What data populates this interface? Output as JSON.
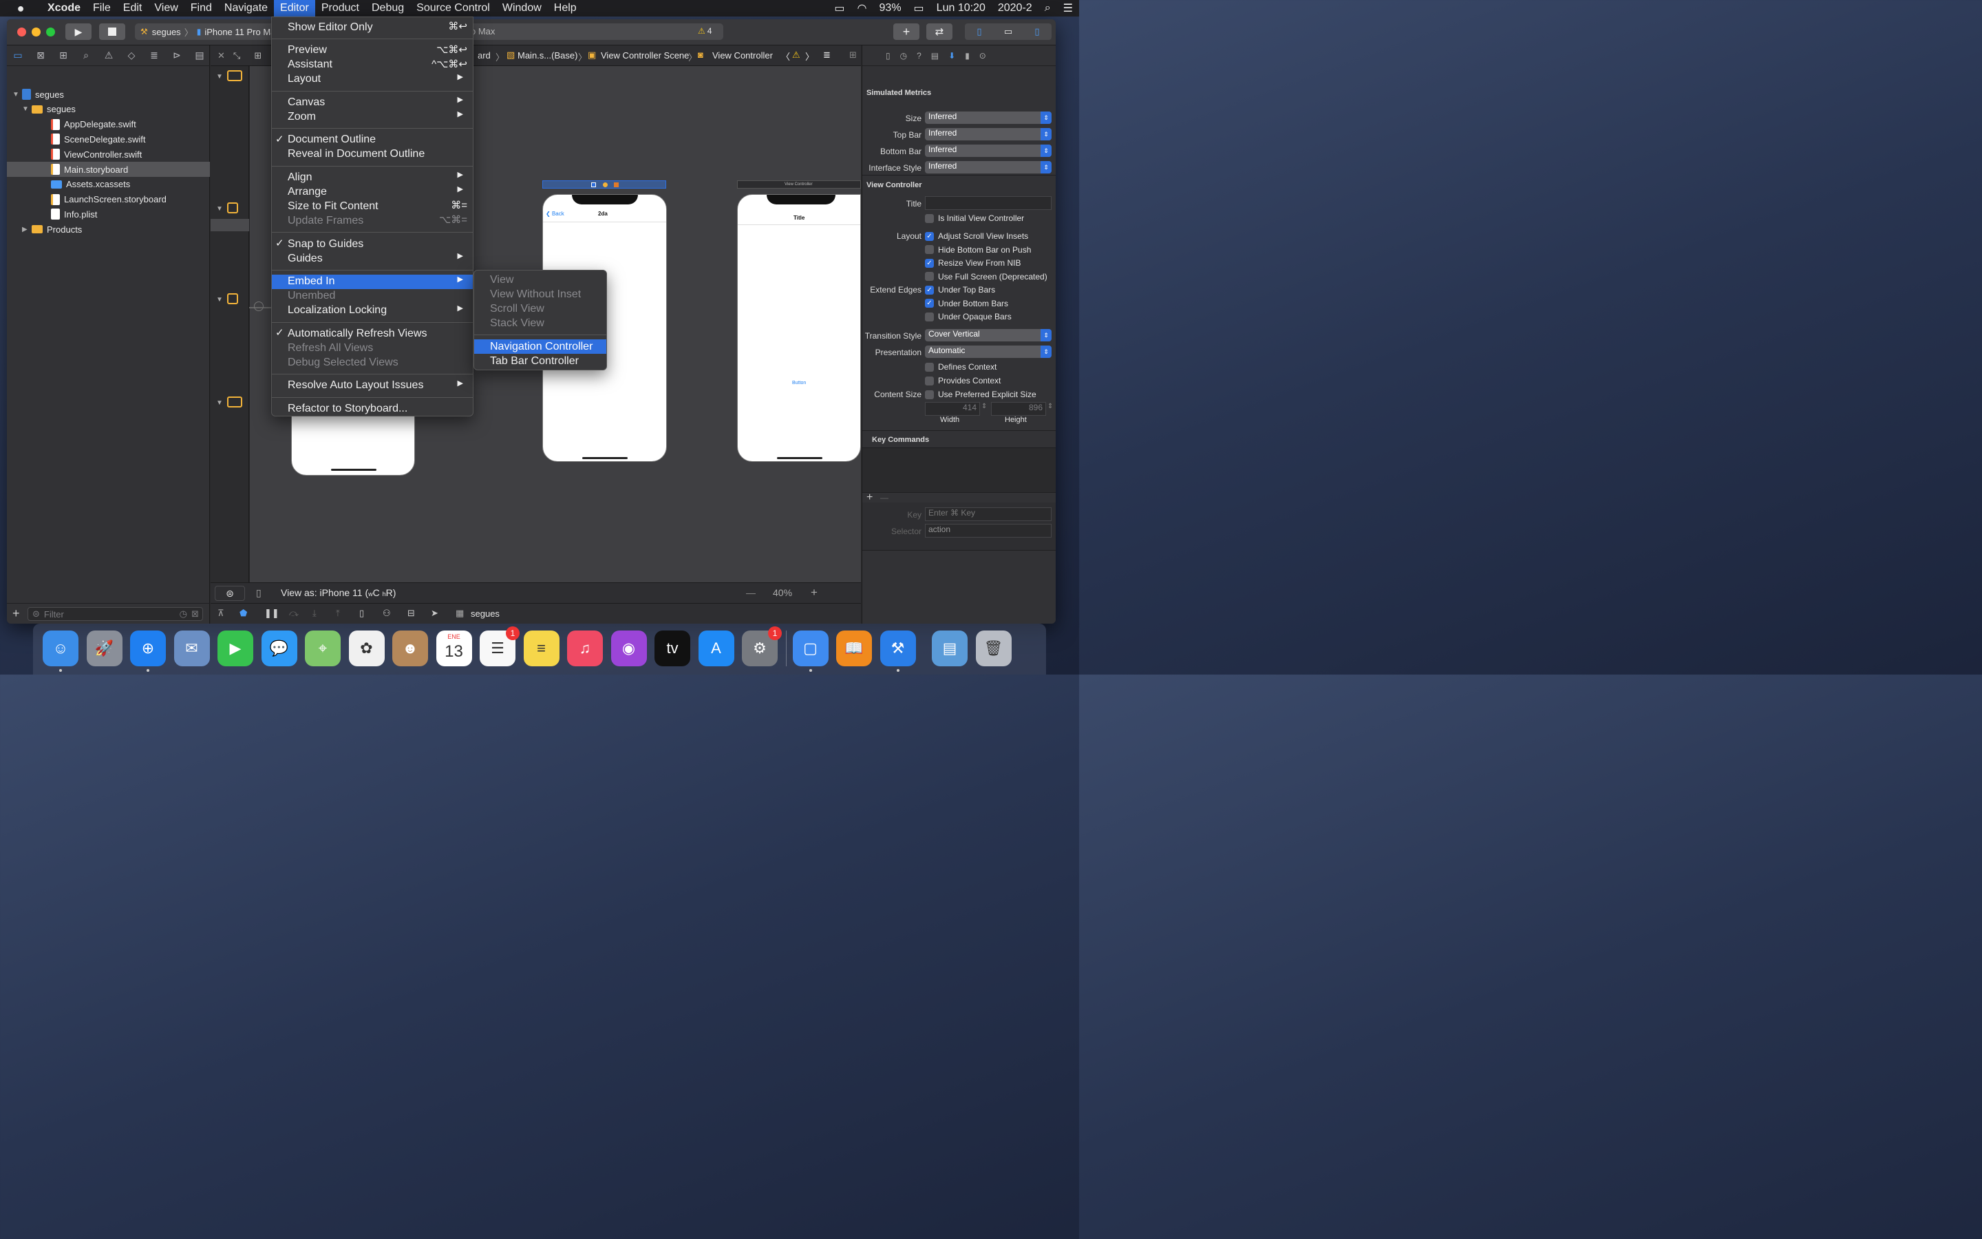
{
  "menubar": {
    "apple": "",
    "app": "Xcode",
    "items": [
      "File",
      "Edit",
      "View",
      "Find",
      "Navigate",
      "Editor",
      "Product",
      "Debug",
      "Source Control",
      "Window",
      "Help"
    ],
    "active": "Editor",
    "status": {
      "battery": "93%",
      "clock": "Lun 10:20",
      "input": "2020-2"
    }
  },
  "toolbar": {
    "scheme": "segues",
    "device": "iPhone 11 Pro Ma",
    "device_tail": "o Max",
    "warnings": "4",
    "plus": "+",
    "swap": "⇄"
  },
  "navigator": {
    "tree": [
      {
        "label": "segues",
        "type": "project",
        "indent": 0,
        "disc": "▼"
      },
      {
        "label": "segues",
        "type": "folder",
        "indent": 1,
        "disc": "▼"
      },
      {
        "label": "AppDelegate.swift",
        "type": "swift",
        "indent": 2,
        "disc": ""
      },
      {
        "label": "SceneDelegate.swift",
        "type": "swift",
        "indent": 2,
        "disc": ""
      },
      {
        "label": "ViewController.swift",
        "type": "swift",
        "indent": 2,
        "disc": ""
      },
      {
        "label": "Main.storyboard",
        "type": "storyboard",
        "indent": 2,
        "disc": "",
        "selected": true
      },
      {
        "label": "Assets.xcassets",
        "type": "assets",
        "indent": 2,
        "disc": ""
      },
      {
        "label": "LaunchScreen.storyboard",
        "type": "storyboard",
        "indent": 2,
        "disc": ""
      },
      {
        "label": "Info.plist",
        "type": "plist",
        "indent": 2,
        "disc": ""
      },
      {
        "label": "Products",
        "type": "folder",
        "indent": 1,
        "disc": "▶"
      }
    ],
    "filter_placeholder": "Filter",
    "add": "+"
  },
  "jumpbar": {
    "crumb1": "ard",
    "crumb2": "Main.s...(Base)",
    "crumb3": "View Controller Scene",
    "crumb4": "View Controller"
  },
  "canvas": {
    "phone2": {
      "back": "Back",
      "title": "2da"
    },
    "phone3": {
      "header": "View Controller",
      "title": "Title",
      "button": "Button"
    }
  },
  "editor_bottom": {
    "view_as_prefix": "View as: iPhone 11 (",
    "w": "w",
    "c": "C",
    "space": " ",
    "h": "h",
    "r": "R",
    "close": ")",
    "zoom": "40%",
    "minus": "—",
    "plus": "+"
  },
  "debugbar": {
    "target": "segues"
  },
  "inspector": {
    "simulated_metrics": "Simulated Metrics",
    "metrics": [
      {
        "label": "Size",
        "value": "Inferred"
      },
      {
        "label": "Top Bar",
        "value": "Inferred"
      },
      {
        "label": "Bottom Bar",
        "value": "Inferred"
      },
      {
        "label": "Interface Style",
        "value": "Inferred"
      }
    ],
    "view_controller": "View Controller",
    "title_label": "Title",
    "initial": "Is Initial View Controller",
    "layout_label": "Layout",
    "layout_opts": [
      {
        "label": "Adjust Scroll View Insets",
        "on": true
      },
      {
        "label": "Hide Bottom Bar on Push",
        "on": false
      },
      {
        "label": "Resize View From NIB",
        "on": true
      },
      {
        "label": "Use Full Screen (Deprecated)",
        "on": false
      }
    ],
    "extend_label": "Extend Edges",
    "extend_opts": [
      {
        "label": "Under Top Bars",
        "on": true
      },
      {
        "label": "Under Bottom Bars",
        "on": true
      },
      {
        "label": "Under Opaque Bars",
        "on": false
      }
    ],
    "transition_label": "Transition Style",
    "transition": "Cover Vertical",
    "presentation_label": "Presentation",
    "presentation": "Automatic",
    "defines": "Defines Context",
    "provides": "Provides Context",
    "content_size_label": "Content Size",
    "preferred": "Use Preferred Explicit Size",
    "width_val": "414",
    "height_val": "896",
    "width": "Width",
    "height": "Height",
    "key_commands": "Key Commands",
    "key_label": "Key",
    "key_placeholder": "Enter ⌘ Key",
    "selector_label": "Selector",
    "selector_value": "action",
    "add": "+",
    "remove": "—"
  },
  "editor_menu": [
    {
      "label": "Show Editor Only",
      "shortcut": "⌘↩"
    },
    {
      "sep": true
    },
    {
      "label": "Preview",
      "shortcut": "⌥⌘↩"
    },
    {
      "label": "Assistant",
      "shortcut": "^⌥⌘↩"
    },
    {
      "label": "Layout",
      "submenu": true
    },
    {
      "sep": true
    },
    {
      "label": "Canvas",
      "submenu": true
    },
    {
      "label": "Zoom",
      "submenu": true
    },
    {
      "sep": true
    },
    {
      "label": "Document Outline",
      "checked": true
    },
    {
      "label": "Reveal in Document Outline"
    },
    {
      "sep": true
    },
    {
      "label": "Align",
      "submenu": true
    },
    {
      "label": "Arrange",
      "submenu": true
    },
    {
      "label": "Size to Fit Content",
      "shortcut": "⌘="
    },
    {
      "label": "Update Frames",
      "shortcut": "⌥⌘=",
      "disabled": true
    },
    {
      "sep": true
    },
    {
      "label": "Snap to Guides",
      "checked": true
    },
    {
      "label": "Guides",
      "submenu": true
    },
    {
      "sep": true
    },
    {
      "label": "Embed In",
      "submenu": true,
      "highlighted": true
    },
    {
      "label": "Unembed",
      "disabled": true
    },
    {
      "label": "Localization Locking",
      "submenu": true
    },
    {
      "sep": true
    },
    {
      "label": "Automatically Refresh Views",
      "checked": true
    },
    {
      "label": "Refresh All Views",
      "disabled": true
    },
    {
      "label": "Debug Selected Views",
      "disabled": true
    },
    {
      "sep": true
    },
    {
      "label": "Resolve Auto Layout Issues",
      "submenu": true
    },
    {
      "sep": true
    },
    {
      "label": "Refactor to Storyboard..."
    }
  ],
  "embed_submenu": [
    {
      "label": "View",
      "disabled": true
    },
    {
      "label": "View Without Inset",
      "disabled": true
    },
    {
      "label": "Scroll View",
      "disabled": true
    },
    {
      "label": "Stack View",
      "disabled": true
    },
    {
      "sep": true
    },
    {
      "label": "Navigation Controller",
      "highlighted": true
    },
    {
      "label": "Tab Bar Controller"
    }
  ],
  "dock": [
    {
      "name": "Finder",
      "icon": "finder-icon",
      "color": "#3b8de8",
      "glyph": "☺",
      "running": true
    },
    {
      "name": "Launchpad",
      "icon": "launchpad-icon",
      "color": "#8a8f99",
      "glyph": "🚀"
    },
    {
      "name": "Safari",
      "icon": "safari-icon",
      "color": "#1f7ff0",
      "glyph": "⊕",
      "running": true
    },
    {
      "name": "Mail",
      "icon": "mail-icon",
      "color": "#6b8fc4",
      "glyph": "✉"
    },
    {
      "name": "FaceTime",
      "icon": "facetime-icon",
      "color": "#37c24f",
      "glyph": "▶"
    },
    {
      "name": "Messages",
      "icon": "messages-icon",
      "color": "#2f9af5",
      "glyph": "💬"
    },
    {
      "name": "Maps",
      "icon": "maps-icon",
      "color": "#7fc66a",
      "glyph": "⌖"
    },
    {
      "name": "Photos",
      "icon": "photos-icon",
      "color": "#f0f0f0",
      "glyph": "✿"
    },
    {
      "name": "Contacts",
      "icon": "contacts-icon",
      "color": "#b5885a",
      "glyph": "☻"
    },
    {
      "name": "Calendar",
      "icon": "calendar-icon",
      "color": "#ffffff",
      "glyph": "13",
      "month": "ENE"
    },
    {
      "name": "Reminders",
      "icon": "reminders-icon",
      "color": "#f8f8f8",
      "glyph": "☰",
      "badge": "1"
    },
    {
      "name": "Notes",
      "icon": "notes-icon",
      "color": "#f6d64a",
      "glyph": "≡"
    },
    {
      "name": "Music",
      "icon": "music-icon",
      "color": "#f04a64",
      "glyph": "♫"
    },
    {
      "name": "Podcasts",
      "icon": "podcasts-icon",
      "color": "#9b45d8",
      "glyph": "◉"
    },
    {
      "name": "TV",
      "icon": "tv-icon",
      "color": "#111111",
      "glyph": "tv"
    },
    {
      "name": "App Store",
      "icon": "appstore-icon",
      "color": "#1f8af5",
      "glyph": "A"
    },
    {
      "name": "System Preferences",
      "icon": "settings-icon",
      "color": "#777a80",
      "glyph": "⚙",
      "badge": "1"
    },
    {
      "name": "Simulator",
      "icon": "simulator-icon",
      "color": "#3f8bf0",
      "glyph": "▢",
      "running": true
    },
    {
      "name": "Books",
      "icon": "books-icon",
      "color": "#f08a1e",
      "glyph": "📖"
    },
    {
      "name": "Xcode",
      "icon": "xcode-icon",
      "color": "#2a7ee8",
      "glyph": "⚒",
      "running": true
    },
    {
      "name": "Downloads",
      "icon": "downloads-folder-icon",
      "color": "#5a9bd8",
      "glyph": "▤"
    },
    {
      "name": "Trash",
      "icon": "trash-icon",
      "color": "#b8bcc4",
      "glyph": "🗑"
    }
  ]
}
